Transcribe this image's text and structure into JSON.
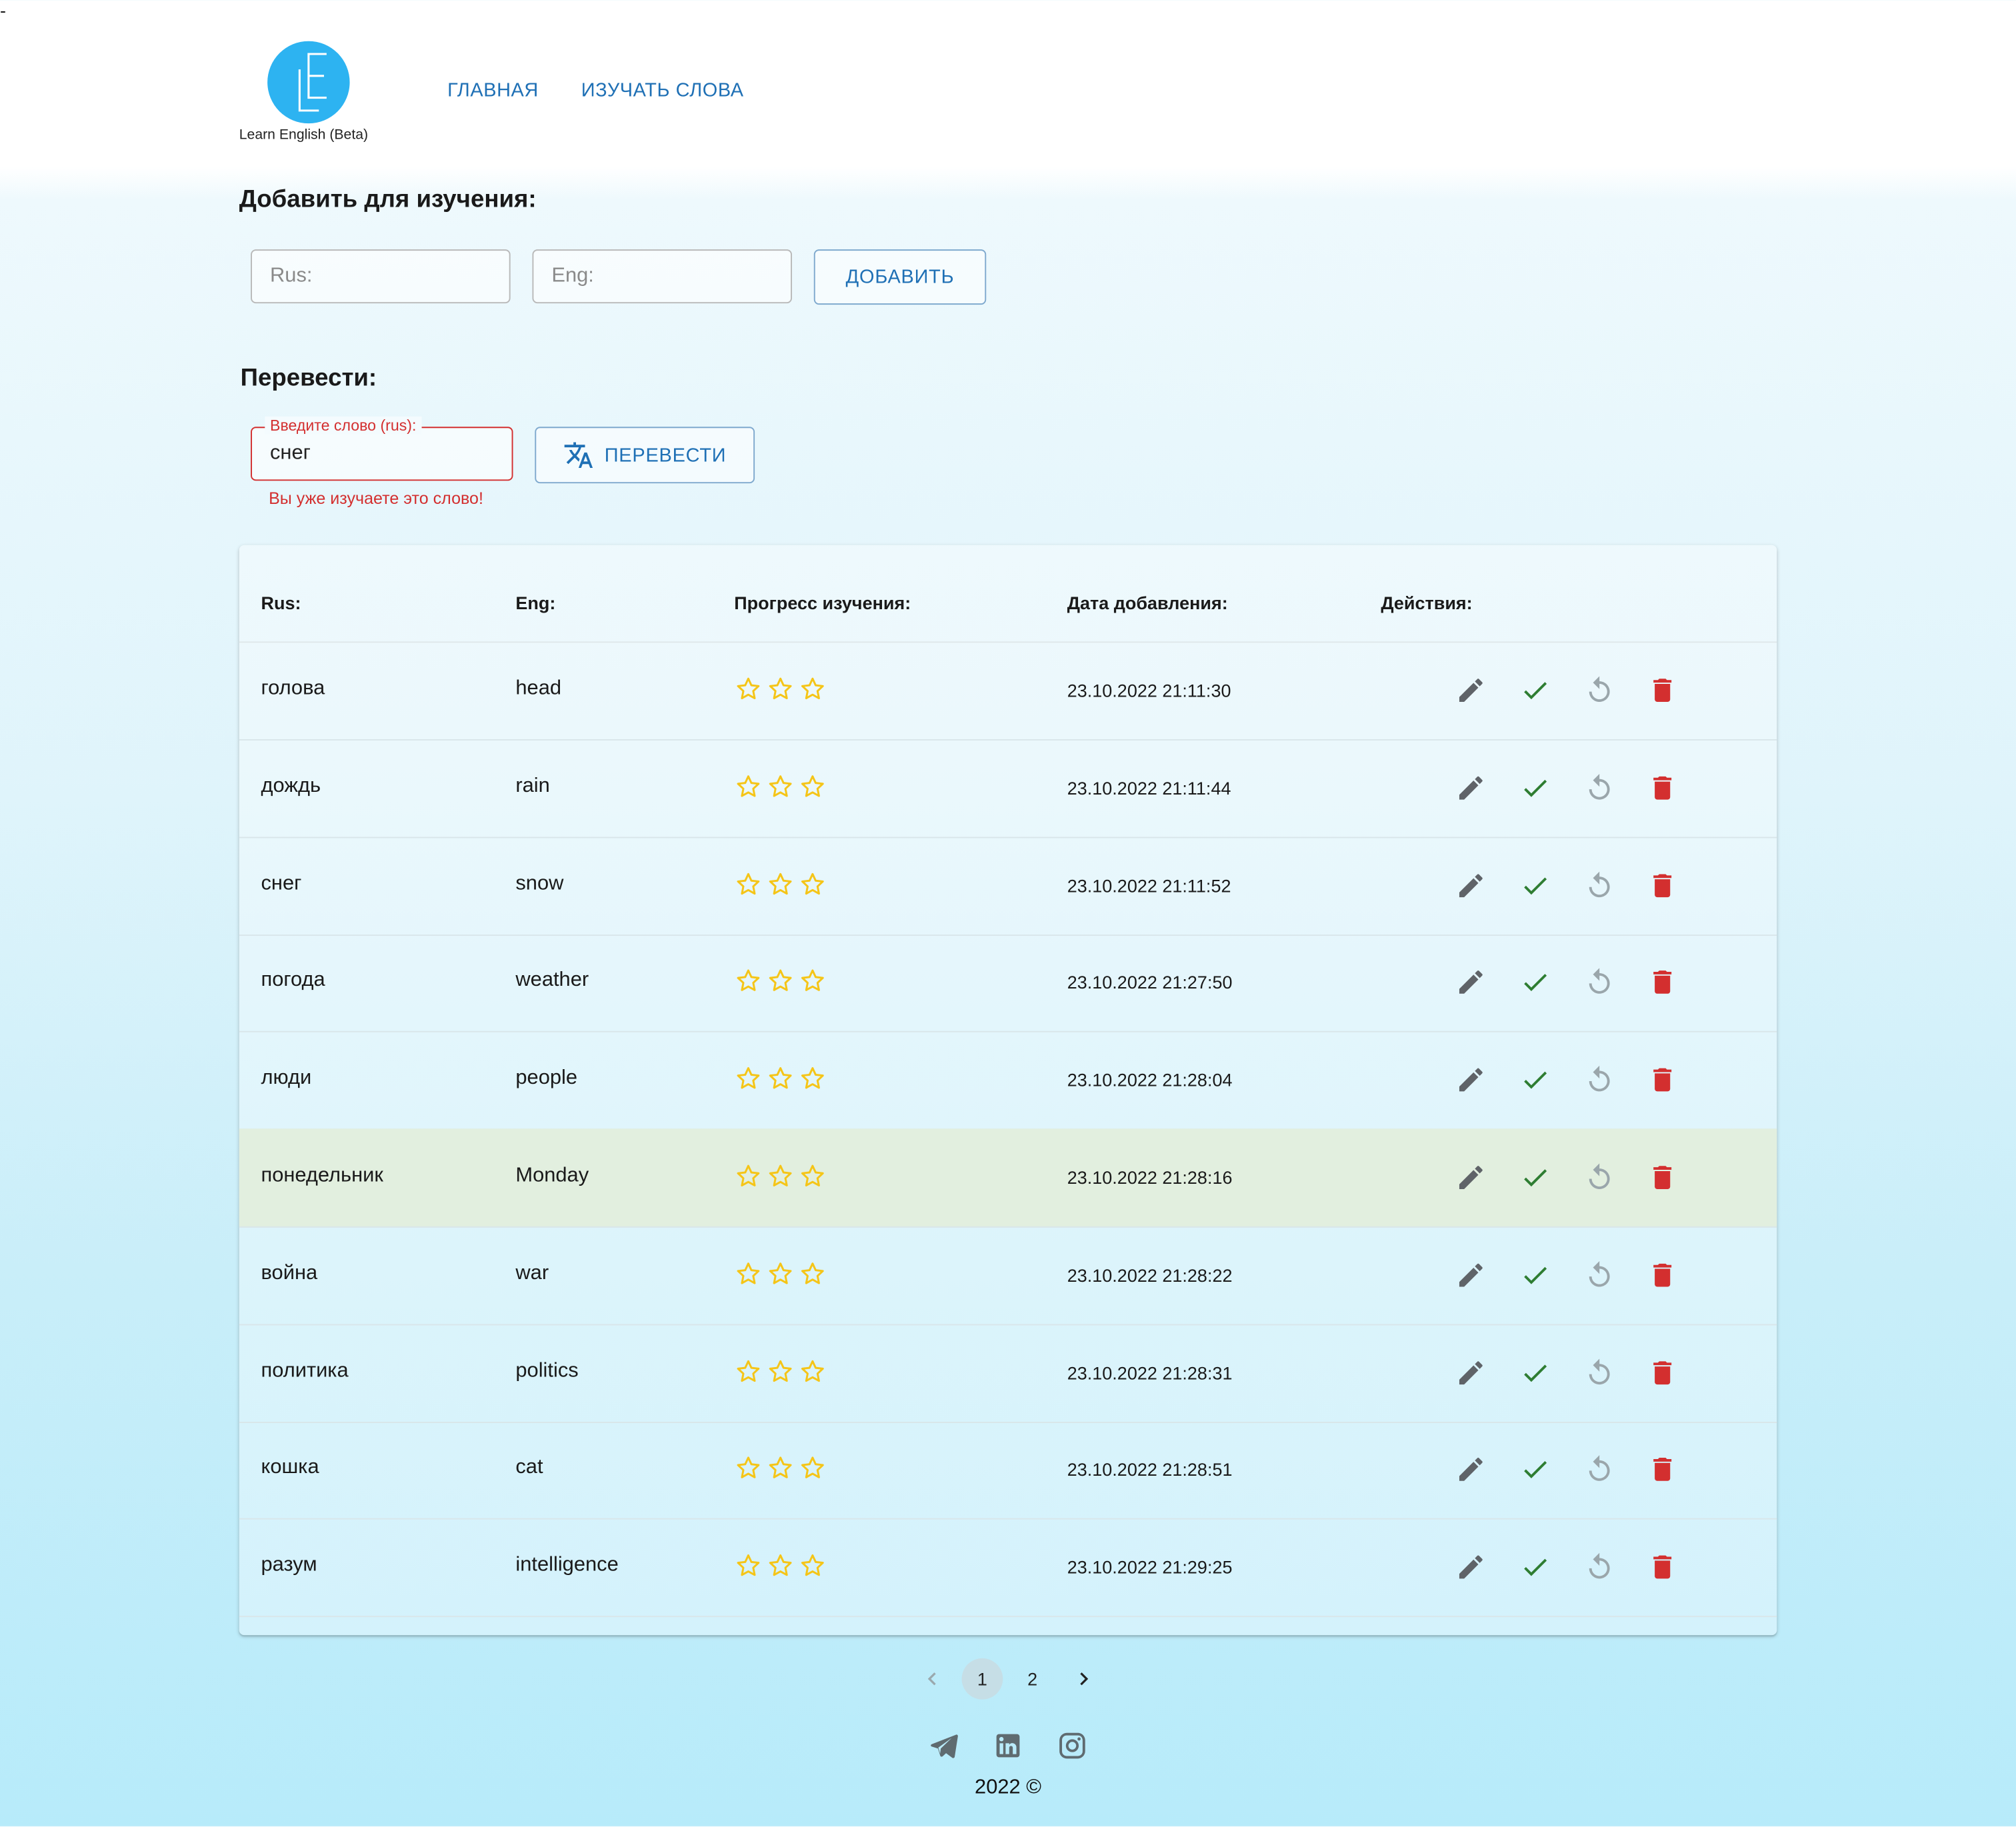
{
  "top_mark": "-",
  "logo": {
    "letters": "LE",
    "text": "Learn English (Beta)"
  },
  "nav": {
    "home": "ГЛАВНАЯ",
    "study": "ИЗУЧАТЬ СЛОВА"
  },
  "add_section": {
    "title": "Добавить для изучения:",
    "rus_placeholder": "Rus:",
    "eng_placeholder": "Eng:",
    "add_button": "ДОБАВИТЬ"
  },
  "translate_section": {
    "title": "Перевести:",
    "input_label": "Введите слово (rus):",
    "input_value": "снег",
    "error_text": "Вы уже изучаете это слово!",
    "translate_button": "ПЕРЕВЕСТИ"
  },
  "table": {
    "headers": {
      "rus": "Rus:",
      "eng": "Eng:",
      "progress": "Прогресс изучения:",
      "date": "Дата добавления:",
      "actions": "Действия:"
    },
    "rows": [
      {
        "rus": "голова",
        "eng": "head",
        "date": "23.10.2022 21:11:30",
        "stars": 0
      },
      {
        "rus": "дождь",
        "eng": "rain",
        "date": "23.10.2022 21:11:44",
        "stars": 0
      },
      {
        "rus": "снег",
        "eng": "snow",
        "date": "23.10.2022 21:11:52",
        "stars": 0
      },
      {
        "rus": "погода",
        "eng": "weather",
        "date": "23.10.2022 21:27:50",
        "stars": 0
      },
      {
        "rus": "люди",
        "eng": "people",
        "date": "23.10.2022 21:28:04",
        "stars": 0
      },
      {
        "rus": "понедельник",
        "eng": "Monday",
        "date": "23.10.2022 21:28:16",
        "stars": 0
      },
      {
        "rus": "война",
        "eng": "war",
        "date": "23.10.2022 21:28:22",
        "stars": 0
      },
      {
        "rus": "политика",
        "eng": "politics",
        "date": "23.10.2022 21:28:31",
        "stars": 0
      },
      {
        "rus": "кошка",
        "eng": "cat",
        "date": "23.10.2022 21:28:51",
        "stars": 0
      },
      {
        "rus": "разум",
        "eng": "intelligence",
        "date": "23.10.2022 21:29:25",
        "stars": 0
      }
    ],
    "highlighted_row": 5
  },
  "pagination": {
    "pages": [
      "1",
      "2"
    ],
    "current": "1"
  },
  "footer": {
    "socials": [
      "telegram-icon",
      "linkedin-icon",
      "instagram-icon"
    ],
    "copyright": "2022 ©"
  },
  "colors": {
    "accent": "#1f70b5",
    "error": "#d32f2f",
    "star": "#f5c518",
    "check": "#2e7d32",
    "delete": "#d32f2f",
    "logo": "#2db3f1"
  }
}
